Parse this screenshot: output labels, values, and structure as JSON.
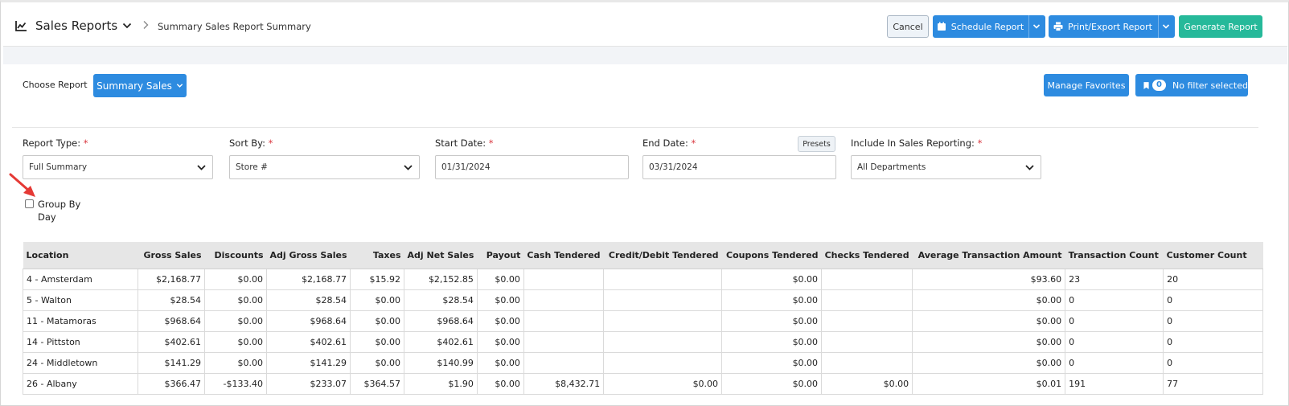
{
  "header": {
    "title": "Sales Reports",
    "breadcrumb": "Summary Sales Report Summary",
    "icons": [
      "chart-line-icon",
      "chevron-down-icon",
      "chevron-right-icon"
    ],
    "cancel_label": "Cancel",
    "schedule_label": "Schedule Report",
    "print_label": "Print/Export Report",
    "generate_label": "Generate Report"
  },
  "choose": {
    "label": "Choose Report",
    "selected_report": "Summary Sales",
    "manage_favorites_label": "Manage Favorites",
    "filter_count": "0",
    "filter_label": "No filter selected"
  },
  "form": {
    "report_type_label": "Report Type:",
    "report_type_value": "Full Summary",
    "sort_by_label": "Sort By:",
    "sort_by_value": "Store #",
    "start_date_label": "Start Date:",
    "start_date_value": "01/31/2024",
    "end_date_label": "End Date:",
    "end_date_value": "03/31/2024",
    "presets_label": "Presets",
    "include_label": "Include In Sales Reporting:",
    "include_value": "All Departments",
    "required_mark": "*",
    "group_by_day_label": "Group By Day",
    "group_by_day_checked": false
  },
  "table": {
    "columns": [
      "Location",
      "Gross Sales",
      "Discounts",
      "Adj Gross Sales",
      "Taxes",
      "Adj Net Sales",
      "Payout",
      "Cash Tendered",
      "Credit/Debit Tendered",
      "Coupons Tendered",
      "Checks Tendered",
      "Average Transaction Amount",
      "Transaction Count",
      "Customer Count"
    ],
    "rows": [
      [
        "4 - Amsterdam",
        "$2,168.77",
        "$0.00",
        "$2,168.77",
        "$15.92",
        "$2,152.85",
        "$0.00",
        "",
        "",
        "$0.00",
        "",
        "$93.60",
        "23",
        "20"
      ],
      [
        "5 - Walton",
        "$28.54",
        "$0.00",
        "$28.54",
        "$0.00",
        "$28.54",
        "$0.00",
        "",
        "",
        "$0.00",
        "",
        "$0.00",
        "0",
        "0"
      ],
      [
        "11 - Matamoras",
        "$968.64",
        "$0.00",
        "$968.64",
        "$0.00",
        "$968.64",
        "$0.00",
        "",
        "",
        "$0.00",
        "",
        "$0.00",
        "0",
        "0"
      ],
      [
        "14 - Pittston",
        "$402.61",
        "$0.00",
        "$402.61",
        "$0.00",
        "$402.61",
        "$0.00",
        "",
        "",
        "$0.00",
        "",
        "$0.00",
        "0",
        "0"
      ],
      [
        "24 - Middletown",
        "$141.29",
        "$0.00",
        "$141.29",
        "$0.00",
        "$140.99",
        "$0.00",
        "",
        "",
        "$0.00",
        "",
        "$0.00",
        "0",
        "0"
      ],
      [
        "26 - Albany",
        "$366.47",
        "-$133.40",
        "$233.07",
        "$364.57",
        "$1.90",
        "$0.00",
        "$8,432.71",
        "$0.00",
        "$0.00",
        "$0.00",
        "$0.01",
        "191",
        "77"
      ]
    ]
  },
  "colors": {
    "primary": "#2d8be0",
    "success": "#26b99a",
    "required": "#d9363e",
    "annotation_arrow": "#e53935"
  }
}
